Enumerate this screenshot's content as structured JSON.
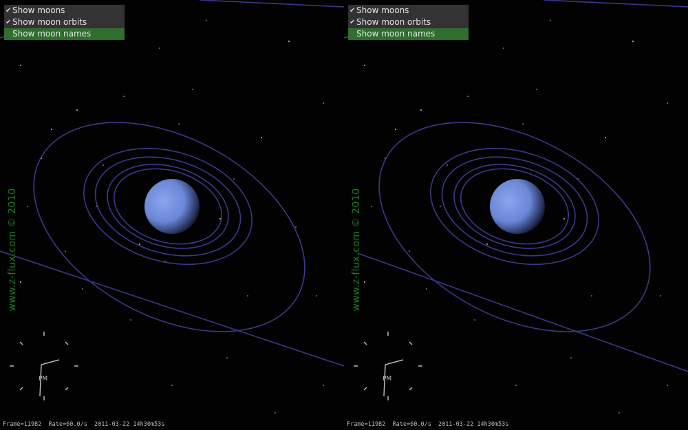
{
  "menu": {
    "items": [
      {
        "label": "Show moons",
        "checked": true
      },
      {
        "label": "Show moon orbits",
        "checked": true
      },
      {
        "label": "Show moon names",
        "checked": false,
        "highlighted": true
      }
    ]
  },
  "watermark": "www.z-flux.com © 2010",
  "clock": {
    "label": "PM"
  },
  "status": "Frame=11982  Rate=60.0/s  2011-03-22 14h30m53s",
  "colors": {
    "menu_highlight": "#2f6e2f",
    "orbit": "#3a3a8c",
    "planet": "#6a86d6",
    "watermark": "#1f7d1f"
  },
  "icons": {
    "check": "checkmark-icon"
  }
}
